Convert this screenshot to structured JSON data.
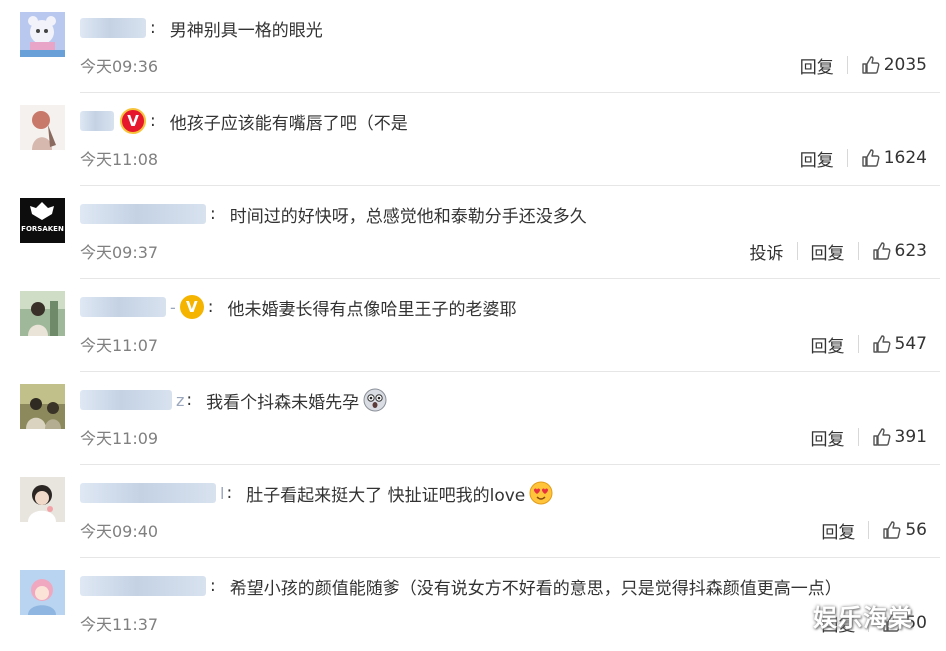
{
  "reply_label": "回复",
  "report_label": "投诉",
  "comments": [
    {
      "text": "男神别具一格的眼光",
      "time": "今天09:36",
      "likes": "2035"
    },
    {
      "text": "他孩子应该能有嘴唇了吧（不是",
      "time": "今天11:08",
      "likes": "1624",
      "badge": "V"
    },
    {
      "text": "时间过的好快呀，总感觉他和泰勒分手还没多久",
      "time": "今天09:37",
      "likes": "623",
      "avatar_text": "FORSAKEN"
    },
    {
      "text": "他未婚妻长得有点像哈里王子的老婆耶",
      "time": "今天11:07",
      "likes": "547",
      "badge": "V",
      "name_suffix": "-"
    },
    {
      "text": "我看个抖森未婚先孕",
      "time": "今天11:09",
      "likes": "391",
      "name_suffix": "z"
    },
    {
      "text": "肚子看起来挺大了 快扯证吧我的love",
      "time": "今天09:40",
      "likes": "56",
      "name_suffix": "l"
    },
    {
      "text": "希望小孩的颜值能随爹（没有说女方不好看的意思，只是觉得抖森颜值更高一点）",
      "time": "今天11:37",
      "likes": "50"
    }
  ],
  "watermark": "娱乐海棠"
}
